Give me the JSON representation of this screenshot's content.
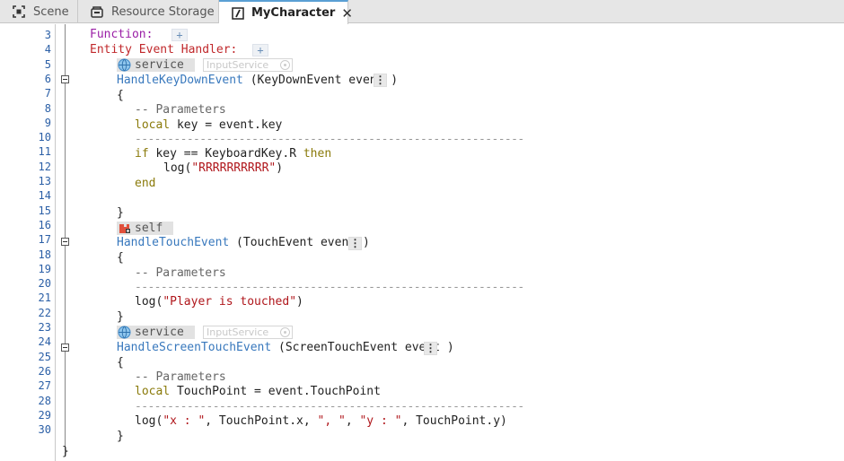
{
  "tabs": [
    {
      "label": "Scene",
      "icon": "scene-icon"
    },
    {
      "label": "Resource Storage",
      "icon": "storage-icon"
    },
    {
      "label": "MyCharacter",
      "icon": "script-icon",
      "active": true,
      "close": "✕"
    }
  ],
  "editor": {
    "line_numbers": [
      "3",
      "4",
      "5",
      "6",
      "7",
      "8",
      "9",
      "10",
      "11",
      "12",
      "13",
      "14",
      "15",
      "16",
      "17",
      "18",
      "19",
      "20",
      "21",
      "22",
      "23",
      "24",
      "25",
      "26",
      "27",
      "28",
      "29",
      "30"
    ],
    "function_label": "Function:",
    "entity_handler_label": "Entity Event Handler:",
    "plus": "+",
    "more": "⋮",
    "service_chip": "service",
    "self_chip": "self",
    "service_placeholder": "InputService",
    "h1_name": "HandleKeyDownEvent",
    "h1_sig": " (KeyDownEvent event )",
    "h2_name": "HandleTouchEvent",
    "h2_sig": " (TouchEvent event )",
    "h3_name": "HandleScreenTouchEvent",
    "h3_sig": " (ScreenTouchEvent event )",
    "open_brace": "{",
    "close_brace": "}",
    "params_comment": "-- Parameters",
    "separator": "------------------------------------------------------------",
    "local_kw": "local",
    "l9_rest": " key = event.key",
    "if_kw": "if",
    "l11_mid": " key == KeyboardKey.R ",
    "then_kw": "then",
    "log_open": "log(",
    "log_close": ")",
    "str_r": "\"RRRRRRRRRR\"",
    "end_kw": "end",
    "str_touched": "\"Player is touched\"",
    "l27_rest": " TouchPoint = event.TouchPoint",
    "str_x": "\"x : \"",
    "l29_a": ", TouchPoint.x, ",
    "str_comma": "\", \"",
    "l29_b": ", ",
    "str_y": "\"y : \"",
    "l29_c": ", TouchPoint.y)",
    "final_brace": "}"
  }
}
